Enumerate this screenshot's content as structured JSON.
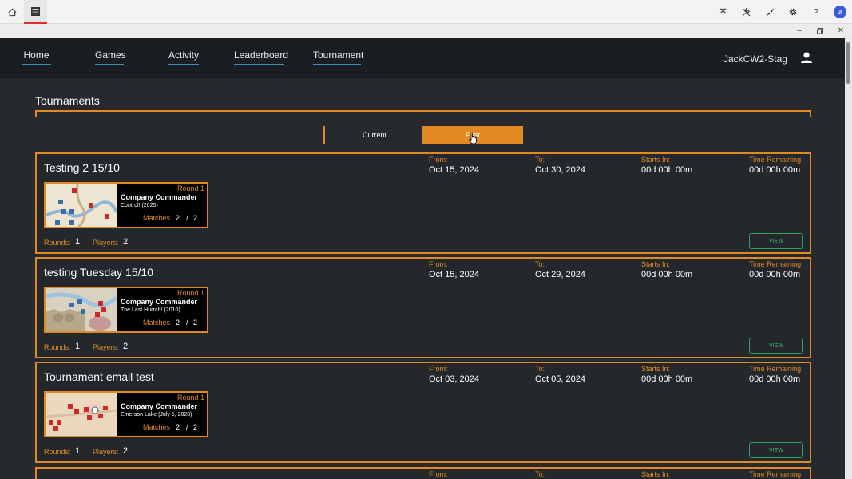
{
  "app": {
    "name": "Company Commander",
    "accent": "#e08a21",
    "nav_bg": "#1a1d22",
    "page_bg": "#26292e"
  },
  "top_strip": {
    "avatar_initials": "JI",
    "icons": [
      "home-icon",
      "app-tab-icon",
      "upload-icon",
      "pin-off-icon",
      "collapse-icon",
      "gear-icon",
      "help-icon",
      "avatar"
    ]
  },
  "nav": {
    "items": [
      "Home",
      "Games",
      "Activity",
      "Leaderboard",
      "Tournament"
    ],
    "username": "JackCW2-Stag"
  },
  "page": {
    "title": "Tournaments"
  },
  "filter": {
    "current_label": "Current",
    "past_label": "Past",
    "selected": "Past"
  },
  "labels": {
    "from": "From:",
    "to": "To:",
    "starts_in": "Starts In:",
    "time_remaining": "Time Remaining:",
    "rounds": "Rounds:",
    "players": "Players:",
    "matches": "Matches",
    "view": "VIEW"
  },
  "tournaments": [
    {
      "name": "Testing 2 15/10",
      "from": "Oct 15, 2024",
      "to": "Oct 30, 2024",
      "starts_in": "00d 00h 00m",
      "time_remaining": "00d 00h 00m",
      "round": "Round 1",
      "game": "Company Commander",
      "scenario": "Control! (2025)",
      "matches_done": "2",
      "matches_sep": "/",
      "matches_total": "2",
      "rounds": "1",
      "players": "2"
    },
    {
      "name": "testing Tuesday 15/10",
      "from": "Oct 15, 2024",
      "to": "Oct 29, 2024",
      "starts_in": "00d 00h 00m",
      "time_remaining": "00d 00h 00m",
      "round": "Round 1",
      "game": "Company Commander",
      "scenario": "The Last Hurrah! (2010)",
      "matches_done": "2",
      "matches_sep": "/",
      "matches_total": "2",
      "rounds": "1",
      "players": "2"
    },
    {
      "name": "Tournament email test",
      "from": "Oct 03, 2024",
      "to": "Oct 05, 2024",
      "starts_in": "00d 00h 00m",
      "time_remaining": "00d 00h 00m",
      "round": "Round 1",
      "game": "Company Commander",
      "scenario": "Emerson Lake (July 5, 2028)",
      "matches_done": "2",
      "matches_sep": "/",
      "matches_total": "2",
      "rounds": "1",
      "players": "2"
    }
  ]
}
